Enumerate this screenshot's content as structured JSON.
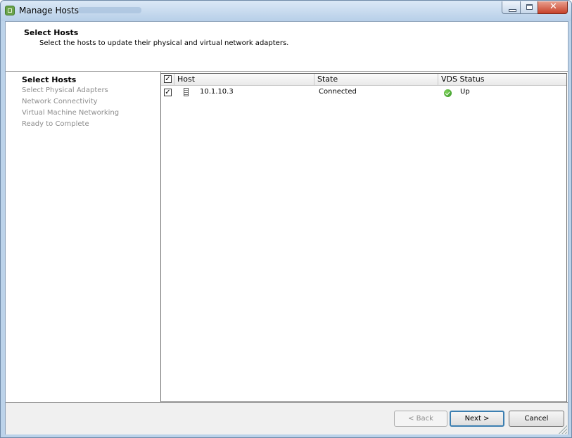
{
  "window": {
    "title": "Manage Hosts"
  },
  "header": {
    "title": "Select Hosts",
    "description": "Select the hosts to update their physical and virtual network adapters."
  },
  "steps": [
    {
      "label": "Select Hosts",
      "active": true
    },
    {
      "label": "Select Physical Adapters",
      "active": false
    },
    {
      "label": "Network Connectivity",
      "active": false
    },
    {
      "label": "Virtual Machine Networking",
      "active": false
    },
    {
      "label": "Ready to Complete",
      "active": false
    }
  ],
  "grid": {
    "select_all_checked": true,
    "columns": [
      "Host",
      "State",
      "VDS Status"
    ],
    "rows": [
      {
        "checked": true,
        "host": "10.1.10.3",
        "state": "Connected",
        "vds_status": "Up",
        "host_icon": "server-icon",
        "status_icon": "green-check-icon"
      }
    ]
  },
  "buttons": {
    "back": "< Back",
    "next": "Next >",
    "cancel": "Cancel"
  },
  "colors": {
    "title_bar": "#bcd3ea",
    "close_button": "#c7412a",
    "status_ok": "#2f8f1f"
  }
}
